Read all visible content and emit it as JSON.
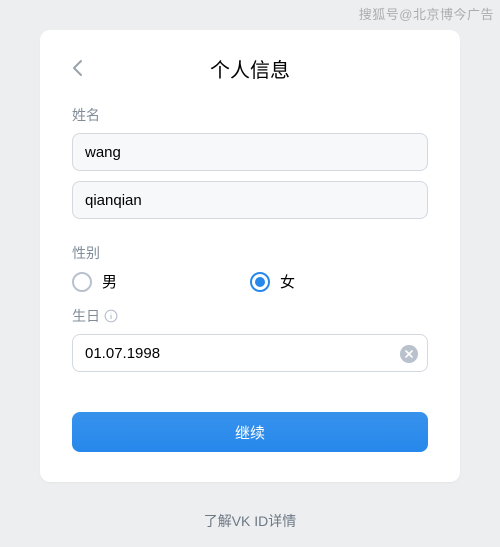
{
  "watermark": "搜狐号@北京博今广告",
  "header": {
    "title": "个人信息"
  },
  "name": {
    "label": "姓名",
    "first_value": "wang",
    "last_value": "qianqian"
  },
  "gender": {
    "label": "性别",
    "options": {
      "male": "男",
      "female": "女"
    },
    "selected": "female"
  },
  "birthday": {
    "label": "生日",
    "value": "01.07.1998"
  },
  "submit_label": "继续",
  "footer_link": "了解VK ID详情"
}
